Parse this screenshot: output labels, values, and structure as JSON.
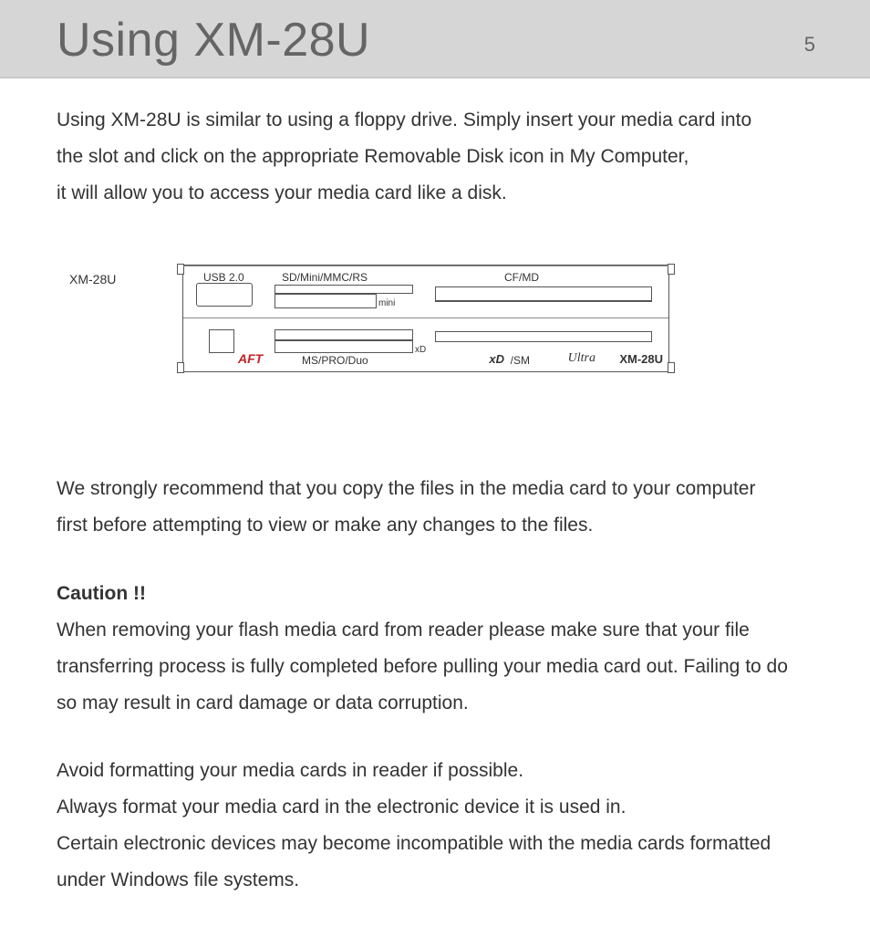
{
  "header": {
    "title": "Using XM-28U",
    "page_number": "5"
  },
  "intro": {
    "line1": "Using XM-28U is similar to using a floppy drive. Simply insert your media card into",
    "line2": "the slot and click on the appropriate Removable Disk icon in My Computer,",
    "line3": "it will allow you to access your media card like a disk."
  },
  "diagram": {
    "side_label": "XM-28U",
    "labels": {
      "usb": "USB 2.0",
      "sd": "SD/Mini/MMC/RS",
      "cf": "CF/MD",
      "mini": "mini",
      "xd": "xD",
      "ms": "MS/PRO/Duo"
    },
    "brand": {
      "aft": "AFT",
      "xd_logo": "xD",
      "sm": "/SM",
      "ultra": "Ultra",
      "model": "XM-28U"
    }
  },
  "recommend": {
    "line1": "We strongly recommend that you copy the files in the media card to your computer",
    "line2": "first before attempting to view or make any changes to the files."
  },
  "caution": {
    "heading": "Caution !!",
    "line1": "When removing your flash media card from reader please make sure that your file",
    "line2": "transferring process is fully completed before pulling your media card out. Failing to do",
    "line3": "so may result in card damage or data corruption."
  },
  "format_advice": {
    "line1": "Avoid formatting your media cards in reader if possible.",
    "line2": "Always format your media card in the electronic device it is used in.",
    "line3": "Certain electronic devices may become incompatible with the media cards formatted",
    "line4": "under Windows file systems."
  }
}
